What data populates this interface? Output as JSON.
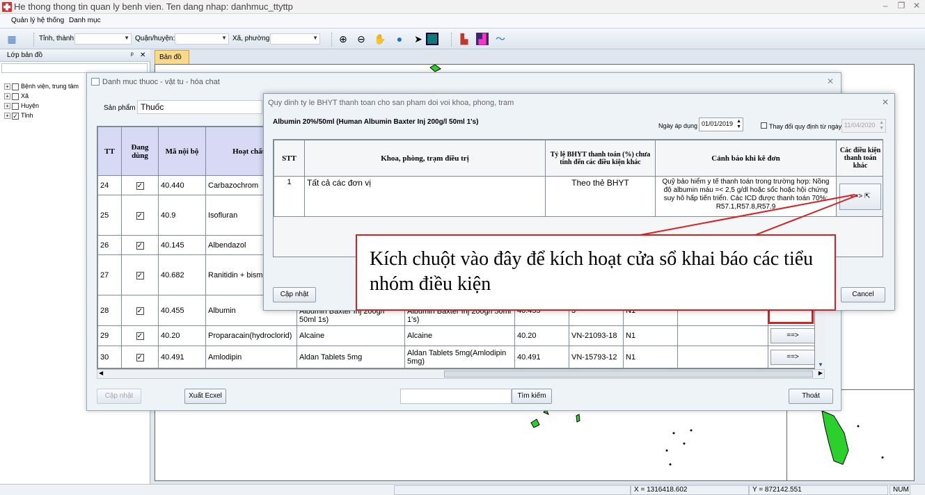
{
  "window": {
    "title": "He thong thong tin quan ly benh vien. Ten dang nhap: danhmuc_ttyttp",
    "controls": {
      "minimize": "–",
      "restore": "❐",
      "close": "✕"
    }
  },
  "menu": {
    "items": [
      "Quản lý hệ thống",
      "Danh mục"
    ]
  },
  "toolbar": {
    "province_label": "Tỉnh, thành:",
    "district_label": "Quận/huyện:",
    "ward_label": "Xã, phường:"
  },
  "left_panel": {
    "title": "Lớp bản đồ",
    "pin": "ᵖ",
    "close": "✕",
    "layers": [
      {
        "label": "Bệnh viện, trung tâm",
        "checked": false
      },
      {
        "label": "Xã",
        "checked": false
      },
      {
        "label": "Huyện",
        "checked": false
      },
      {
        "label": "Tỉnh",
        "checked": true
      }
    ]
  },
  "map": {
    "tab_label": "Bản đồ"
  },
  "status": {
    "x": "X = 1316418.602",
    "y": "Y = 872142.551",
    "num": "NUM"
  },
  "dialog_products": {
    "title": "Danh muc thuoc - vật tu - hóa chat",
    "product_label": "Sản phẩm",
    "product_value": "Thuốc",
    "headers": [
      "TT",
      "Đang dùng",
      "Mã nội bộ",
      "Hoạt chất c"
    ],
    "rows": [
      {
        "tt": "24",
        "active": true,
        "code": "40.440",
        "ingredient": "Carbazochrom",
        "name": "",
        "name2": "",
        "code2": "",
        "reg": "",
        "group": ""
      },
      {
        "tt": "25",
        "active": true,
        "code": "40.9",
        "ingredient": "Isofluran",
        "name": "",
        "name2": "",
        "code2": "",
        "reg": "",
        "group": ""
      },
      {
        "tt": "26",
        "active": true,
        "code": "40.145",
        "ingredient": "Albendazol",
        "name": "",
        "name2": "",
        "code2": "",
        "reg": "",
        "group": ""
      },
      {
        "tt": "27",
        "active": true,
        "code": "40.682",
        "ingredient": "Ranitidin + bism sucralfat",
        "name": "",
        "name2": "",
        "code2": "",
        "reg": "",
        "group": ""
      },
      {
        "tt": "28",
        "active": true,
        "code": "40.455",
        "ingredient": "Albumin",
        "name": "Albumin Baxter Inj 200g/l 50ml 1s)",
        "name2": "Albumin Baxter Inj 200g/l 50ml 1's)",
        "code2": "40.455",
        "reg": "3",
        "group": "N1"
      },
      {
        "tt": "29",
        "active": true,
        "code": "40.20",
        "ingredient": "Proparacain(hydroclorid)",
        "name": "Alcaine",
        "name2": "Alcaine",
        "code2": "40.20",
        "reg": "VN-21093-18",
        "group": "N1"
      },
      {
        "tt": "30",
        "active": true,
        "code": "40.491",
        "ingredient": "Amlodipin",
        "name": "Aldan Tablets 5mg",
        "name2": "Aldan Tablets 5mg(Amlodipin 5mg)",
        "code2": "40.491",
        "reg": "VN-15793-12",
        "group": "N1"
      }
    ],
    "arrow_label": "==>",
    "buttons": {
      "update": "Cập nhật",
      "export": "Xuất Ecxel",
      "search": "Tìm kiếm",
      "exit": "Thoát"
    },
    "search_value": ""
  },
  "dialog_rate": {
    "title": "Quy dinh ty le BHYT thanh toan  cho san pham doi voi  khoa, phong, tram",
    "product_name": "Albumin 20%/50ml (Human Albumin Baxter Inj 200g/l 50ml 1's)",
    "date_label": "Ngày áp dụng",
    "date_value": "01/01/2019",
    "change_label": "Thay đổi quy định từ ngày",
    "change_date": "11/04/2020",
    "headers": {
      "stt": "STT",
      "dept": "Khoa, phòng, trạm điều trị",
      "rate": "Tỷ lệ BHYT thanh toán (%) chưa tính đến các điều kiện khác",
      "warning": "Cảnh báo khi kê đơn",
      "conditions": "Các điều kiện thanh toán khác"
    },
    "row": {
      "stt": "1",
      "dept": "Tất cả các đơn vị",
      "rate": "Theo thẻ BHYT",
      "warning": "Quỹ bảo hiểm y tế thanh toán trong trường hợp: Nồng độ albumin máu =< 2,5 g/dl hoặc sốc hoặc hội chứng suy hô hấp tiến triển. Các ICD được thanh toán 70%: R57.1,R57.8,R57.9",
      "conditions_btn": "==>"
    },
    "buttons": {
      "update": "Cập nhật",
      "cancel": "Cancel"
    }
  },
  "callout": {
    "text": "Kích chuột vào đây để kích hoạt cửa sổ khai báo các tiểu nhóm điều kiện"
  },
  "colors": {
    "header_purple": "#d8daf5",
    "callout_red": "#d62121",
    "map_tab": "#f9d98a",
    "map_green": "#2cd02c"
  }
}
